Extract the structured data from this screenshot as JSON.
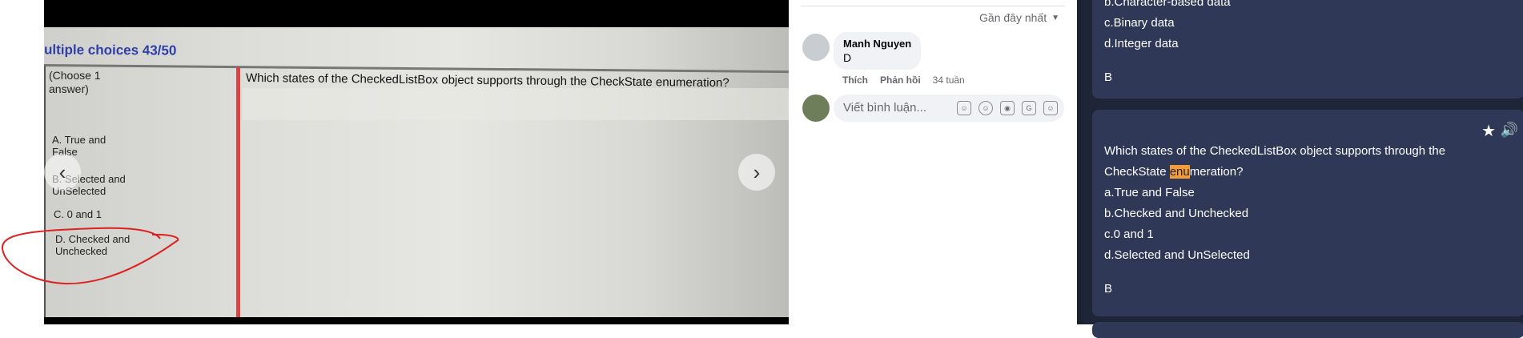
{
  "photo": {
    "title": "ultiple choices 43/50",
    "choose": [
      "(Choose 1",
      "answer)"
    ],
    "question": "Which states of the CheckedListBox object supports through the CheckState enumeration?",
    "options": {
      "a": [
        "A.  True and",
        "False"
      ],
      "b": [
        "B. Selected and",
        "UnSelected"
      ],
      "c": "C.  0 and 1",
      "d": [
        "D.  Checked and",
        "Unchecked"
      ]
    },
    "prev_icon": "chevron-left-icon",
    "next_icon": "chevron-right-icon"
  },
  "comments": {
    "sort_label": "Gần đây nhất",
    "items": [
      {
        "name": "Manh Nguyen",
        "text": "D",
        "like": "Thích",
        "reply": "Phản hồi",
        "time": "34 tuần"
      }
    ],
    "input_placeholder": "Viết bình luận...",
    "tools": [
      "avatar-sticker-icon",
      "emoji-icon",
      "camera-icon",
      "gif-icon",
      "sticker-icon"
    ]
  },
  "quiz": {
    "card1": {
      "lines": [
        "b.Character-based data",
        "c.Binary data",
        "d.Integer data"
      ],
      "answer": "B"
    },
    "card2": {
      "q_line1": "Which states of the CheckedListBox object supports through the",
      "q_line2_pre": "CheckState ",
      "q_line2_hl": "enu",
      "q_line2_post": "meration?",
      "options": [
        "a.True and False",
        "b.Checked and Unchecked",
        "c.0 and 1",
        "d.Selected and UnSelected"
      ],
      "answer": "B"
    }
  },
  "colors": {
    "panel_bg": "#1e2537",
    "card_bg": "#2f3856",
    "highlight": "#f29b37",
    "photo_title": "#2e3fa8",
    "red_mark": "#d64545"
  }
}
